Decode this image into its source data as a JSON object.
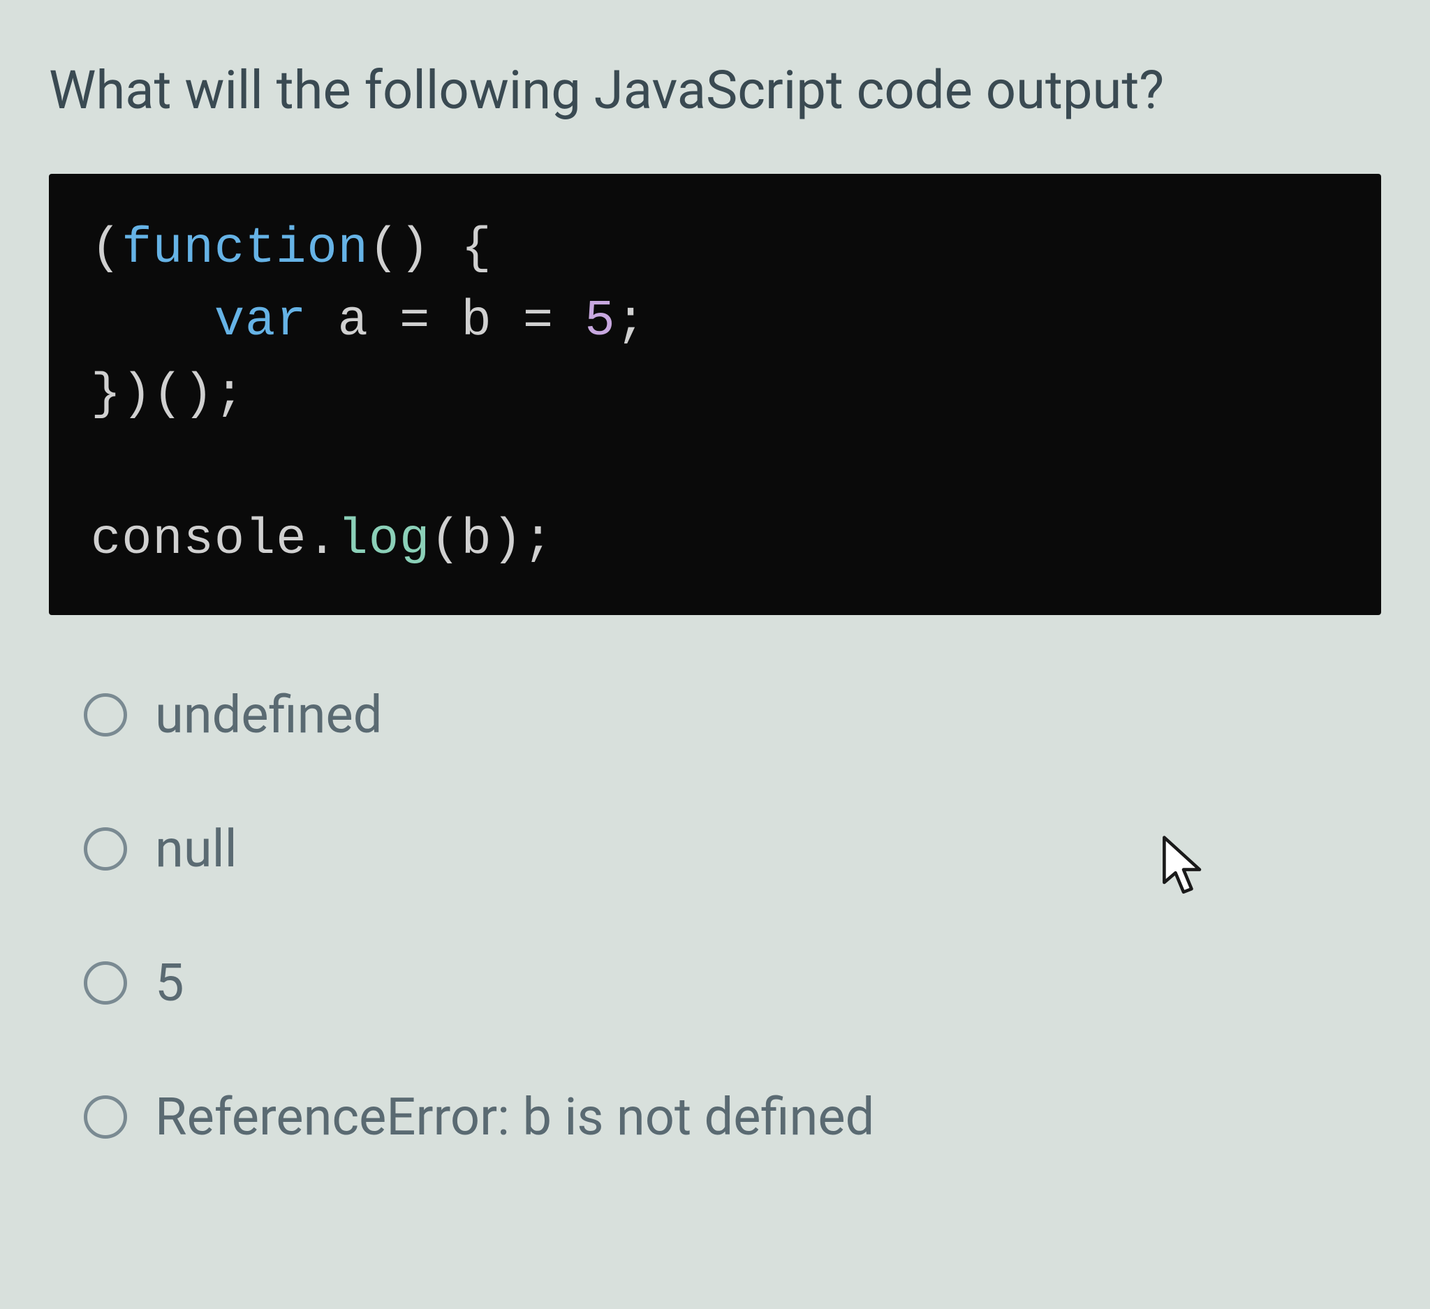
{
  "question": {
    "title": "What will the following JavaScript code output?",
    "code": {
      "line1_open": "(",
      "line1_fn": "function",
      "line1_parenbrace": "() {",
      "line2_indent": "    ",
      "line2_var": "var",
      "line2_rest": " a = b = ",
      "line2_num": "5",
      "line2_semi": ";",
      "line3": "})();",
      "line4": "",
      "line5_console": "console.",
      "line5_log": "log",
      "line5_arg": "(b);"
    },
    "options": [
      {
        "label": "undefined"
      },
      {
        "label": "null"
      },
      {
        "label": "5"
      },
      {
        "label": "ReferenceError: b is not defined"
      }
    ]
  }
}
